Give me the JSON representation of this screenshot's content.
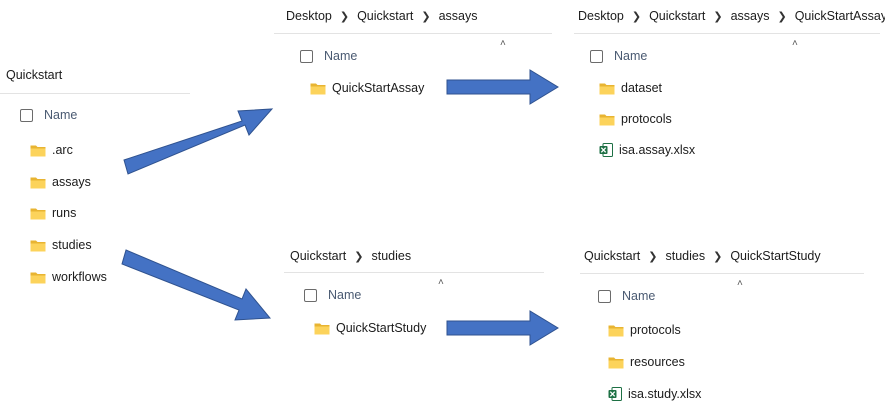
{
  "colors": {
    "arrow_fill": "#4472c4",
    "arrow_stroke": "#2f528f",
    "folder_back": "#e8b432",
    "folder_front": "#fcd35b",
    "excel_green": "#1d7044"
  },
  "left": {
    "title": "Quickstart",
    "header": "Name",
    "items": [
      {
        "icon": "folder-icon",
        "label": ".arc"
      },
      {
        "icon": "folder-icon",
        "label": "assays"
      },
      {
        "icon": "folder-icon",
        "label": "runs"
      },
      {
        "icon": "folder-icon",
        "label": "studies"
      },
      {
        "icon": "folder-icon",
        "label": "workflows"
      }
    ]
  },
  "assays": {
    "crumbs": [
      "Desktop",
      "Quickstart",
      "assays"
    ],
    "header": "Name",
    "items": [
      {
        "icon": "folder-icon",
        "label": "QuickStartAssay"
      }
    ]
  },
  "assay_detail": {
    "crumbs": [
      "Desktop",
      "Quickstart",
      "assays",
      "QuickStartAssay"
    ],
    "header": "Name",
    "items": [
      {
        "icon": "folder-icon",
        "label": "dataset"
      },
      {
        "icon": "folder-icon",
        "label": "protocols"
      },
      {
        "icon": "excel-icon",
        "label": "isa.assay.xlsx"
      }
    ]
  },
  "studies": {
    "crumbs": [
      "Quickstart",
      "studies"
    ],
    "header": "Name",
    "items": [
      {
        "icon": "folder-icon",
        "label": "QuickStartStudy"
      }
    ]
  },
  "study_detail": {
    "crumbs": [
      "Quickstart",
      "studies",
      "QuickStartStudy"
    ],
    "header": "Name",
    "items": [
      {
        "icon": "folder-icon",
        "label": "protocols"
      },
      {
        "icon": "folder-icon",
        "label": "resources"
      },
      {
        "icon": "excel-icon",
        "label": "isa.study.xlsx"
      }
    ]
  }
}
